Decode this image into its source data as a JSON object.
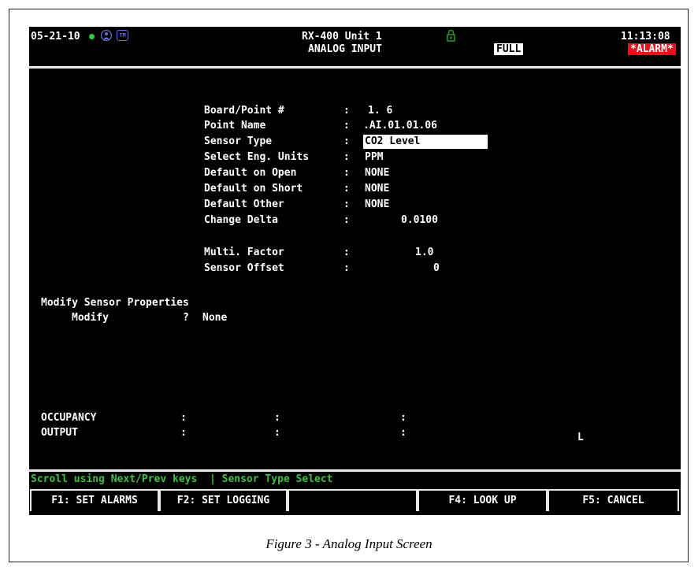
{
  "header": {
    "date": "05-21-10",
    "unit_title": "RX-400 Unit 1",
    "screen_title": "ANALOG INPUT",
    "mode_badge": "FULL",
    "time": "11:13:08",
    "alarm_badge": "*ALARM*",
    "icons": [
      "status-dot-icon",
      "person-icon",
      "tm-icon",
      "lock-icon"
    ],
    "colors": {
      "status_dot": "#2ecc40",
      "alarm_bg": "#e8101a",
      "status_text": "#3fbf3f",
      "lock": "#2a9a2a"
    }
  },
  "fields": [
    {
      "label": "Board/Point #",
      "sep": ":",
      "value": "1. 6"
    },
    {
      "label": "Point Name",
      "sep": ":",
      "value": ".AI.01.01.06"
    },
    {
      "label": "Sensor Type",
      "sep": ":",
      "value": "CO2 Level"
    },
    {
      "label": "Select Eng. Units",
      "sep": ":",
      "value": "PPM"
    },
    {
      "label": "Default on Open",
      "sep": ":",
      "value": "NONE"
    },
    {
      "label": "Default on Short",
      "sep": ":",
      "value": "NONE"
    },
    {
      "label": "Default Other",
      "sep": ":",
      "value": "NONE"
    },
    {
      "label": "Change Delta",
      "sep": ":",
      "value": "0.0100"
    },
    {
      "label": "Multi. Factor",
      "sep": ":",
      "value": "1.0"
    },
    {
      "label": "Sensor Offset",
      "sep": ":",
      "value": "0"
    }
  ],
  "modify": {
    "heading": "Modify Sensor Properties",
    "label": "Modify",
    "sep": "?",
    "value": "None"
  },
  "bottom_rows": [
    {
      "label": "OCCUPANCY",
      "colons": [
        ":",
        ":",
        ":"
      ],
      "extra": ""
    },
    {
      "label": "OUTPUT",
      "colons": [
        ":",
        ":",
        ":"
      ],
      "extra": "L"
    }
  ],
  "status_bar": "Scroll using Next/Prev keys  | Sensor Type Select",
  "fkeys": [
    "F1: SET ALARMS",
    "F2: SET LOGGING",
    "",
    "F4: LOOK UP",
    "F5: CANCEL"
  ],
  "caption": "Figure 3 - Analog Input Screen"
}
